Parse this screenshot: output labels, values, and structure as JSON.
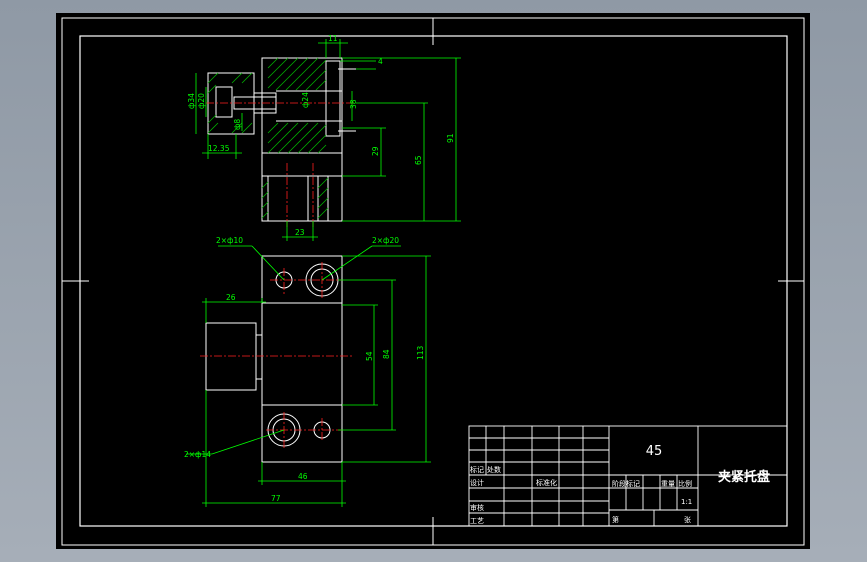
{
  "colors": {
    "background": "#000000",
    "line": "#ffffff",
    "dimension": "#00ff00",
    "centerline": "#ff0000",
    "hatch": "#00cc00"
  },
  "top_view": {
    "dims": {
      "d_11": "11",
      "d_4": "4",
      "d_phi34": "ф34",
      "d_phi20": "ф20",
      "d_phi24": "ф24",
      "d_38": "38",
      "d_29": "29",
      "d_65": "65",
      "d_91": "91",
      "d_12_35": "12.35",
      "d_phi8": "ф8",
      "d_23": "23"
    }
  },
  "front_view": {
    "dims": {
      "holes_10": "2×ф10",
      "holes_20": "2×ф20",
      "holes_14": "2×ф14",
      "d_26": "26",
      "d_54": "54",
      "d_84": "84",
      "d_113": "113",
      "d_46": "46",
      "d_77": "77"
    }
  },
  "title_block": {
    "material": "45",
    "part_name": "夹紧托盘",
    "scale": "1:1",
    "row_labels": {
      "mark": "标记",
      "count": "处数",
      "design": "设计",
      "check": "审核",
      "process": "工艺",
      "standardize": "标准化",
      "stage_mark": "阶段标记",
      "weight": "重量",
      "ratio": "比例",
      "sheet": "第",
      "total": "张"
    }
  }
}
